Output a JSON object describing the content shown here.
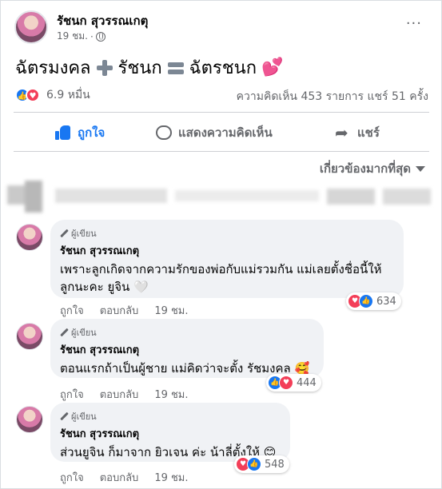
{
  "post": {
    "author": "รัชนก สุวรรณเกตุ",
    "time": "19 ชม.",
    "separator": "·",
    "more": "···",
    "text_part1": "ฉัตรมงคล",
    "text_part2": "รัชนก",
    "text_part3": "ฉัตรชนก",
    "hearts_glyph": "💕"
  },
  "reactions": {
    "count": "6.9 หมื่น",
    "summary": "ความคิดเห็น 453 รายการ  แชร์ 51 ครั้ง",
    "like_glyph": "👍",
    "love_glyph": "♥"
  },
  "actions": {
    "like": "ถูกใจ",
    "comment": "แสดงความคิดเห็น",
    "share": "แชร์"
  },
  "sort_label": "เกี่ยวข้องมากที่สุด",
  "comments": [
    {
      "badge": "ผู้เขียน",
      "name": "รัชนก สุวรรณเกตุ",
      "text": "เพราะลูกเกิดจากความรักของพ่อกับแม่รวมกัน แม่เลยตั้งชื่อนี้ให้ลูกนะคะ ยูจิน 🤍",
      "like": "ถูกใจ",
      "reply": "ตอบกลับ",
      "time": "19 ชม.",
      "reactions": "634",
      "react1": "♥",
      "react2": "👍"
    },
    {
      "badge": "ผู้เขียน",
      "name": "รัชนก สุวรรณเกตุ",
      "text": "ตอนแรกถ้าเป็นผู้ชาย แม่คิดว่าจะตั้ง รัชมงคล 🥰",
      "like": "ถูกใจ",
      "reply": "ตอบกลับ",
      "time": "19 ชม.",
      "reactions": "444",
      "react1": "👍",
      "react2": "♥"
    },
    {
      "badge": "ผู้เขียน",
      "name": "รัชนก สุวรรณเกตุ",
      "text": "ส่วนยูจิน ก็มาจาก ยิวเจน ค่ะ น้าลี่ตั้งให้ 😊",
      "like": "ถูกใจ",
      "reply": "ตอบกลับ",
      "time": "19 ชม.",
      "reactions": "548",
      "react1": "♥",
      "react2": "👍"
    }
  ],
  "colors": {
    "like_blue": "#1877f2",
    "love_red": "#f33e58",
    "secondary_text": "#65676b",
    "bubble_bg": "#f0f2f5"
  }
}
